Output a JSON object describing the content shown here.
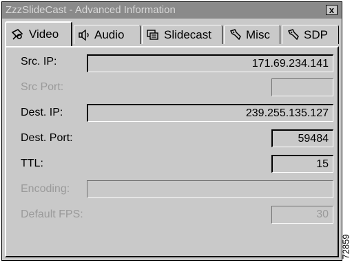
{
  "window": {
    "title": "ZzzSlideCast - Advanced Information",
    "close_label": "x"
  },
  "tabs": [
    {
      "label": "Video",
      "icon": "camera-icon",
      "active": true
    },
    {
      "label": "Audio",
      "icon": "speaker-icon",
      "active": false
    },
    {
      "label": "Slidecast",
      "icon": "slides-icon",
      "active": false
    },
    {
      "label": "Misc",
      "icon": "wrench-icon",
      "active": false
    },
    {
      "label": "SDP",
      "icon": "wrench-icon",
      "active": false
    }
  ],
  "fields": {
    "src_ip": {
      "label": "Src. IP:",
      "value": "171.69.234.141",
      "enabled": true
    },
    "src_port": {
      "label": "Src Port:",
      "value": "",
      "enabled": false
    },
    "dest_ip": {
      "label": "Dest. IP:",
      "value": "239.255.135.127",
      "enabled": true
    },
    "dest_port": {
      "label": "Dest. Port:",
      "value": "59484",
      "enabled": true
    },
    "ttl": {
      "label": "TTL:",
      "value": "15",
      "enabled": true
    },
    "encoding": {
      "label": "Encoding:",
      "value": "",
      "enabled": false
    },
    "default_fps": {
      "label": "Default FPS:",
      "value": "30",
      "enabled": false
    }
  },
  "figure_code": "72859"
}
